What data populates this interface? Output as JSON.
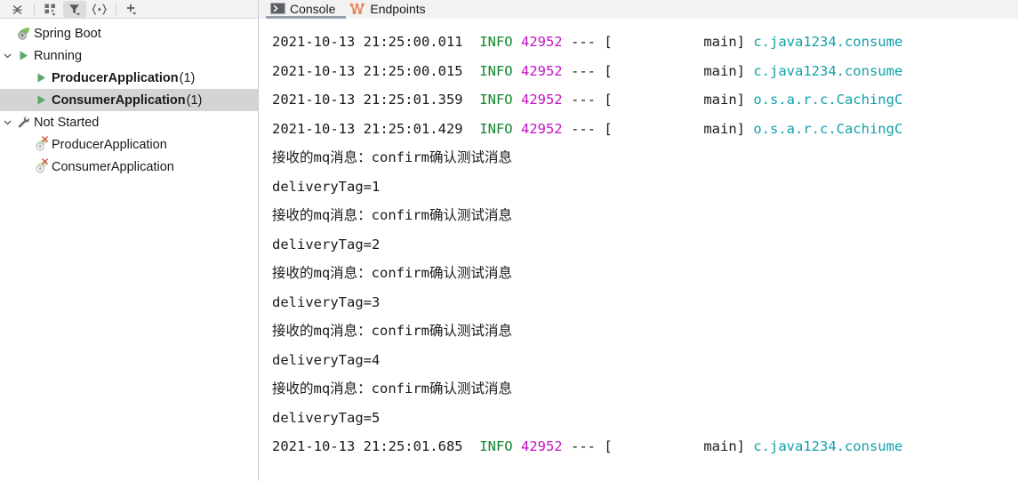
{
  "toolbar": {
    "buttons": [
      {
        "name": "collapse-all-icon",
        "label": "Collapse All",
        "dropdown": false,
        "active": false
      },
      {
        "name": "group-by-icon",
        "label": "Group By",
        "dropdown": true,
        "active": false
      },
      {
        "name": "filter-icon",
        "label": "Filter",
        "dropdown": true,
        "active": true
      },
      {
        "name": "expand-selection-icon",
        "label": "Expand Selection",
        "dropdown": false,
        "active": false
      },
      {
        "name": "add-icon",
        "label": "Add Configuration",
        "dropdown": true,
        "active": false
      }
    ]
  },
  "sidebar": {
    "items": [
      {
        "label": "Spring Boot",
        "count": "",
        "icon": "spring-leaf-icon",
        "indent": 1,
        "twisty": "",
        "bold": false,
        "selected": false
      },
      {
        "label": "Running",
        "count": "",
        "icon": "run-play-icon",
        "indent": 1,
        "twisty": "v",
        "bold": false,
        "selected": false
      },
      {
        "label": "ProducerApplication",
        "count": "(1)",
        "icon": "run-play-icon",
        "indent": 3,
        "twisty": "",
        "bold": true,
        "selected": false
      },
      {
        "label": "ConsumerApplication",
        "count": "(1)",
        "icon": "run-play-icon",
        "indent": 3,
        "twisty": "",
        "bold": true,
        "selected": true
      },
      {
        "label": "Not Started",
        "count": "",
        "icon": "wrench-icon",
        "indent": 1,
        "twisty": "v",
        "bold": false,
        "selected": false
      },
      {
        "label": "ProducerApplication",
        "count": "",
        "icon": "spring-leaf-error-icon",
        "indent": 3,
        "twisty": "",
        "bold": false,
        "selected": false
      },
      {
        "label": "ConsumerApplication",
        "count": "",
        "icon": "spring-leaf-error-icon",
        "indent": 3,
        "twisty": "",
        "bold": false,
        "selected": false
      }
    ]
  },
  "tabs": [
    {
      "label": "Console",
      "icon": "console-icon",
      "active": true
    },
    {
      "label": "Endpoints",
      "icon": "endpoints-icon",
      "active": false
    }
  ],
  "console": {
    "lines": [
      {
        "type": "log",
        "ts": "2021-10-13 21:25:00.011",
        "level": "INFO",
        "pid": "42952",
        "dash": "---",
        "thread": "[           main]",
        "logger": "c.java1234.consume"
      },
      {
        "type": "log",
        "ts": "2021-10-13 21:25:00.015",
        "level": "INFO",
        "pid": "42952",
        "dash": "---",
        "thread": "[           main]",
        "logger": "c.java1234.consume"
      },
      {
        "type": "log",
        "ts": "2021-10-13 21:25:01.359",
        "level": "INFO",
        "pid": "42952",
        "dash": "---",
        "thread": "[           main]",
        "logger": "o.s.a.r.c.CachingC"
      },
      {
        "type": "log",
        "ts": "2021-10-13 21:25:01.429",
        "level": "INFO",
        "pid": "42952",
        "dash": "---",
        "thread": "[           main]",
        "logger": "o.s.a.r.c.CachingC"
      },
      {
        "type": "msg",
        "text": "接收的mq消息：confirm确认测试消息"
      },
      {
        "type": "msg",
        "text": "deliveryTag=1"
      },
      {
        "type": "msg",
        "text": "接收的mq消息：confirm确认测试消息"
      },
      {
        "type": "msg",
        "text": "deliveryTag=2"
      },
      {
        "type": "msg",
        "text": "接收的mq消息：confirm确认测试消息"
      },
      {
        "type": "msg",
        "text": "deliveryTag=3"
      },
      {
        "type": "msg",
        "text": "接收的mq消息：confirm确认测试消息"
      },
      {
        "type": "msg",
        "text": "deliveryTag=4"
      },
      {
        "type": "msg",
        "text": "接收的mq消息：confirm确认测试消息"
      },
      {
        "type": "msg",
        "text": "deliveryTag=5"
      },
      {
        "type": "log",
        "ts": "2021-10-13 21:25:01.685",
        "level": "INFO",
        "pid": "42952",
        "dash": "---",
        "thread": "[           main]",
        "logger": "c.java1234.consume"
      }
    ]
  },
  "colors": {
    "level": "#12872d",
    "pid": "#c313c3",
    "logger": "#12a0a8",
    "selection": "#d4d4d4",
    "tab_underline": "#98a1b0",
    "spring_green": "#6db33f",
    "endpoints_orange": "#e8895d",
    "error_red": "#d63b2f"
  }
}
